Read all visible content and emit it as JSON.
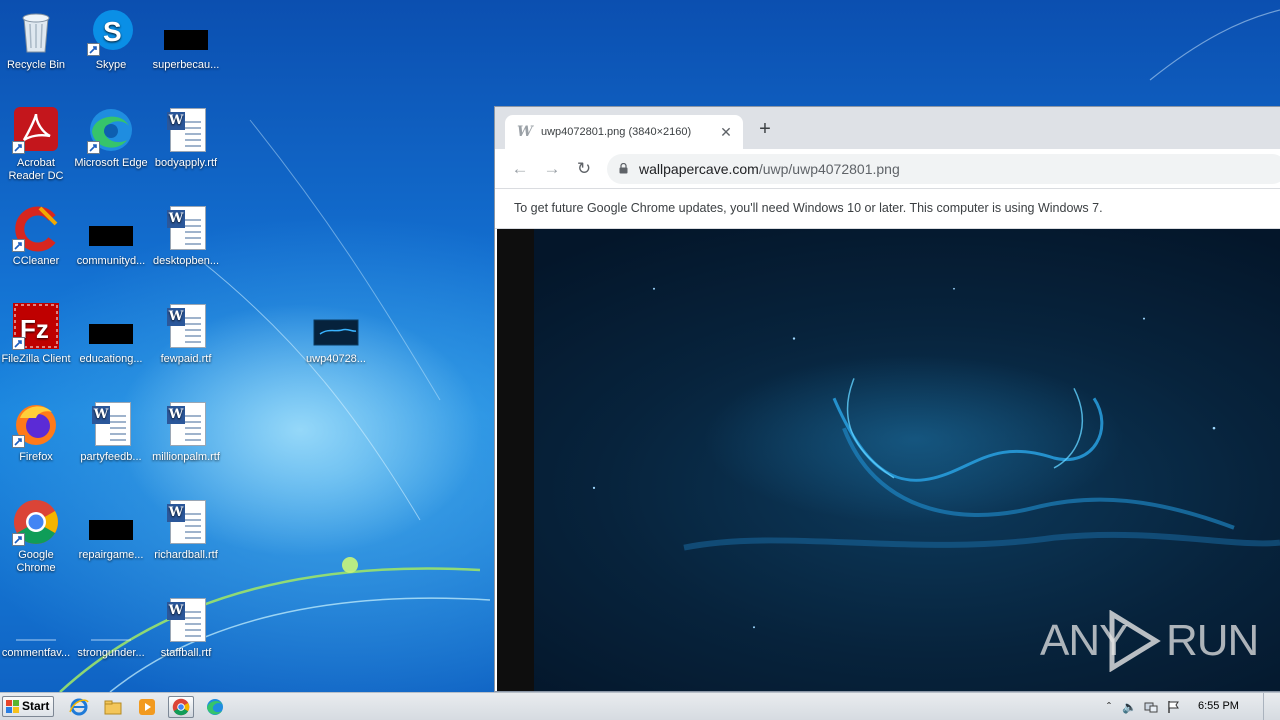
{
  "desktop": {
    "icons": [
      {
        "label": "Recycle Bin"
      },
      {
        "label": "Skype"
      },
      {
        "label": "superbecau..."
      },
      {
        "label": "Acrobat Reader DC"
      },
      {
        "label": "Microsoft Edge"
      },
      {
        "label": "bodyapply.rtf"
      },
      {
        "label": "CCleaner"
      },
      {
        "label": "communityd..."
      },
      {
        "label": "desktopben..."
      },
      {
        "label": "FileZilla Client"
      },
      {
        "label": "educationg..."
      },
      {
        "label": "fewpaid.rtf"
      },
      {
        "label": "uwp40728..."
      },
      {
        "label": "Firefox"
      },
      {
        "label": "partyfeedb..."
      },
      {
        "label": "millionpalm.rtf"
      },
      {
        "label": "Google Chrome"
      },
      {
        "label": "repairgame..."
      },
      {
        "label": "richardball.rtf"
      },
      {
        "label": "commentfav..."
      },
      {
        "label": "strongunder..."
      },
      {
        "label": "staffball.rtf"
      }
    ]
  },
  "browser": {
    "tab_title": "uwp4072801.png (3840×2160)",
    "tab_close": "✕",
    "new_tab": "+",
    "url_host": "wallpapercave.com",
    "url_path": "/uwp/uwp4072801.png",
    "infobar_text": "To get future Google Chrome updates, you'll need Windows 10 or later. This computer is using Windows 7."
  },
  "watermark": {
    "left": "ANY",
    "right": "RUN"
  },
  "taskbar": {
    "start_label": "Start",
    "clock": "6:55 PM"
  },
  "colors": {
    "desktop_blue": "#136fd0",
    "chrome_tabstrip": "#dee1e6",
    "word_blue": "#2b579a"
  }
}
